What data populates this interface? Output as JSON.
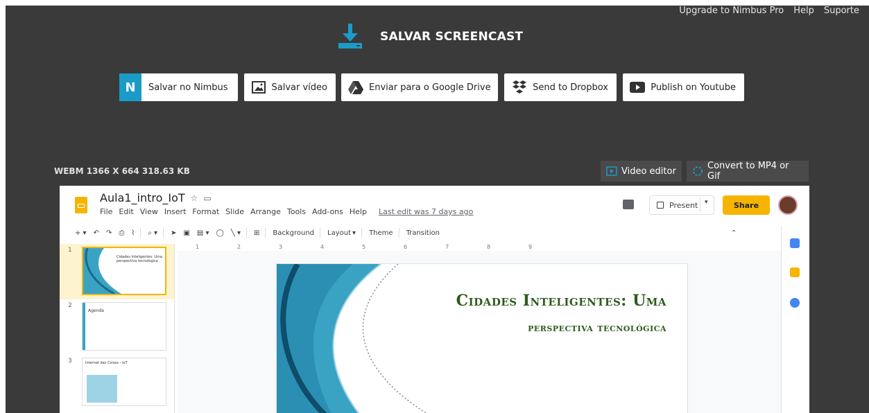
{
  "header": {
    "links": [
      "Upgrade to Nimbus Pro",
      "Help",
      "Suporte"
    ],
    "title": "SALVAR SCREENCAST"
  },
  "actions": [
    {
      "label": "Salvar no Nimbus",
      "icon": "nimbus-icon"
    },
    {
      "label": "Salvar vídeo",
      "icon": "image-icon"
    },
    {
      "label": "Enviar para o Google Drive",
      "icon": "google-drive-icon"
    },
    {
      "label": "Send to Dropbox",
      "icon": "dropbox-icon"
    },
    {
      "label": "Publish on Youtube",
      "icon": "youtube-icon"
    }
  ],
  "file_info": "WEBM 1366 X 664 318.63 KB",
  "tools": {
    "video_editor": "Video editor",
    "convert": "Convert to MP4 or Gif"
  },
  "colors": {
    "background": "#3a3a3a",
    "accent": "#1b9bc7",
    "slides_yellow": "#f5b400",
    "title_green": "#2e5a1e"
  },
  "video": {
    "doc_name": "Aula1_intro_IoT",
    "menu": [
      "File",
      "Edit",
      "View",
      "Insert",
      "Format",
      "Slide",
      "Arrange",
      "Tools",
      "Add-ons",
      "Help"
    ],
    "last_edit": "Last edit was 7 days ago",
    "present": "Present",
    "share": "Share",
    "toolbar": [
      "Background",
      "Layout",
      "Theme",
      "Transition"
    ],
    "ruler": [
      "1",
      "2",
      "3",
      "4",
      "5",
      "6",
      "7",
      "8",
      "9"
    ],
    "thumbnails": [
      {
        "num": "1",
        "text": "Cidades Inteligentes: Uma perspectiva tecnológica"
      },
      {
        "num": "2",
        "text": "Agenda"
      },
      {
        "num": "3",
        "text": "Internet das Coisas - IoT"
      }
    ],
    "slide_title_line1": "Cidades Inteligentes: Uma",
    "slide_title_line2": "perspectiva tecnológica"
  }
}
